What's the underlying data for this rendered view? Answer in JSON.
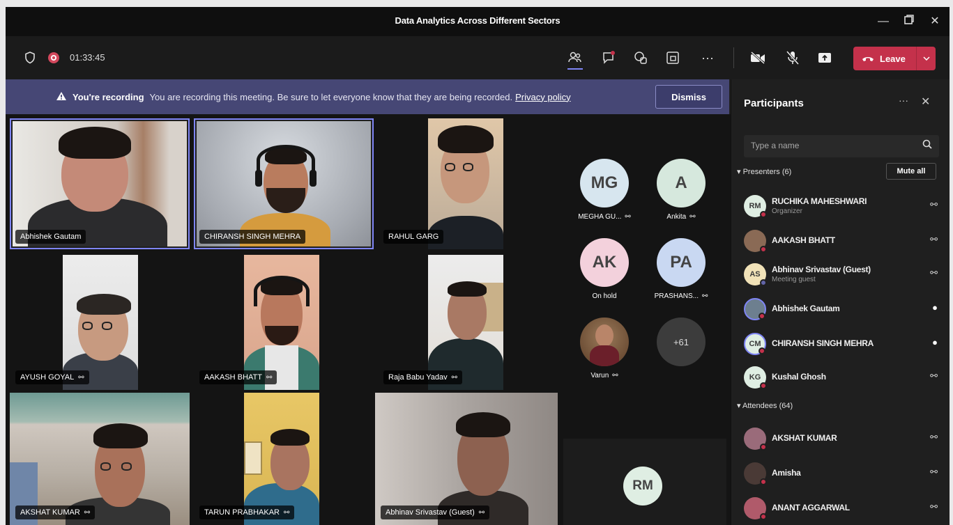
{
  "window": {
    "title": "Data Analytics Across Different Sectors"
  },
  "toolbar": {
    "timer": "01:33:45",
    "leave_label": "Leave",
    "icons": [
      "shield-icon",
      "record-icon",
      "people-icon",
      "chat-icon",
      "reactions-icon",
      "rooms-icon",
      "more-icon",
      "camera-off-icon",
      "mic-off-icon",
      "share-icon"
    ]
  },
  "banner": {
    "bold": "You're recording",
    "message": "You are recording this meeting. Be sure to let everyone know that they are being recorded.",
    "link": "Privacy policy",
    "dismiss": "Dismiss"
  },
  "video_tiles": [
    {
      "name": "Abhishek Gautam"
    },
    {
      "name": "CHIRANSH SINGH MEHRA"
    },
    {
      "name": "RAHUL GARG"
    },
    {
      "name": "AYUSH GOYAL"
    },
    {
      "name": "AAKASH BHATT"
    },
    {
      "name": "Raja Babu Yadav"
    },
    {
      "name": "AKSHAT KUMAR"
    },
    {
      "name": "TARUN PRABHAKAR"
    },
    {
      "name": "Abhinav Srivastav (Guest)"
    }
  ],
  "avatar_gallery": [
    {
      "initials": "MG",
      "label": "MEGHA GU...",
      "color": "#d7e6ef"
    },
    {
      "initials": "A",
      "label": "Ankita",
      "color": "#d6e8dd"
    },
    {
      "initials": "AK",
      "label": "On hold",
      "color": "#f3d1dc"
    },
    {
      "initials": "PA",
      "label": "PRASHANS...",
      "color": "#c9d8f2"
    },
    {
      "initials": "",
      "label": "Varun",
      "color": "#7a5b3a"
    },
    {
      "initials": "+61",
      "label": "",
      "color": "#3c3c3c"
    }
  ],
  "spotlight": {
    "initials": "RM",
    "color": "#dfeee3"
  },
  "participants": {
    "title": "Participants",
    "search_placeholder": "Type a name",
    "presenters_label": "Presenters (6)",
    "mute_all": "Mute all",
    "attendees_label": "Attendees (64)",
    "presenters": [
      {
        "name": "RUCHIKA MAHESHWARI",
        "sub": "Organizer",
        "initials": "RM",
        "color": "#dfeee3"
      },
      {
        "name": "AAKASH BHATT",
        "sub": "",
        "initials": "",
        "color": "#8a6a55"
      },
      {
        "name": "Abhinav Srivastav (Guest)",
        "sub": "Meeting guest",
        "initials": "AS",
        "color": "#f1e2b8"
      },
      {
        "name": "Abhishek Gautam",
        "sub": "",
        "initials": "",
        "color": "#6d7f8f"
      },
      {
        "name": "CHIRANSH SINGH MEHRA",
        "sub": "",
        "initials": "CM",
        "color": "#dfeee3"
      },
      {
        "name": "Kushal Ghosh",
        "sub": "",
        "initials": "KG",
        "color": "#dfeee3"
      }
    ],
    "attendees": [
      {
        "name": "AKSHAT KUMAR",
        "initials": "",
        "color": "#9a6b7a"
      },
      {
        "name": "Amisha",
        "initials": "",
        "color": "#4a3a36"
      },
      {
        "name": "ANANT AGGARWAL",
        "initials": "",
        "color": "#b05a6a"
      }
    ]
  },
  "colors": {
    "accent": "#7f85f5",
    "leave": "#c4314b",
    "banner": "#464775"
  }
}
